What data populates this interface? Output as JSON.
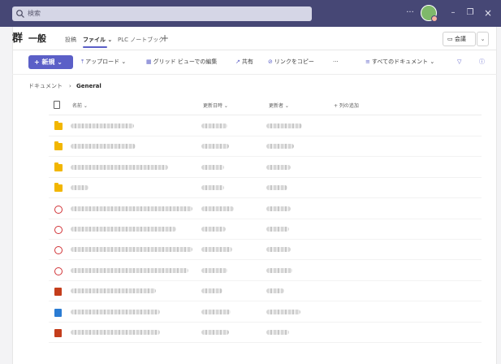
{
  "titlebar": {
    "search_placeholder": "検索",
    "more_label": "···",
    "minimize_label": "–",
    "maximize_label": "❐",
    "close_label": "×"
  },
  "channel": {
    "team_logo_text": "群",
    "name": "一般",
    "tabs": [
      {
        "label": "投稿",
        "active": false
      },
      {
        "label": "ファイル",
        "active": true
      },
      {
        "label": "PLC ノートブック",
        "active": false
      }
    ],
    "add_tab_label": "+",
    "meet_label": "会議"
  },
  "commandbar": {
    "new_label": "新規",
    "upload_label": "アップロード",
    "gridview_label": "グリッド ビューでの編集",
    "share_label": "共有",
    "copylink_label": "リンクをコピー",
    "more_label": "···",
    "view_label": "すべてのドキュメント"
  },
  "breadcrumb": {
    "root": "ドキュメント",
    "current": "General"
  },
  "columns": {
    "name": "名前",
    "modified": "更新日時",
    "modified_by": "更新者",
    "add_column": "+ 列の追加"
  },
  "rows": [
    {
      "type": "folder"
    },
    {
      "type": "folder"
    },
    {
      "type": "folder"
    },
    {
      "type": "folder"
    },
    {
      "type": "pdf"
    },
    {
      "type": "pdf"
    },
    {
      "type": "pdf"
    },
    {
      "type": "pdf"
    },
    {
      "type": "pptx"
    },
    {
      "type": "docx"
    },
    {
      "type": "pptx"
    }
  ],
  "colors": {
    "titlebar": "#464775",
    "accent": "#5b5fc7",
    "folder": "#f2b600",
    "pdf": "#d13438",
    "pptx": "#c43e1c",
    "docx": "#2b7cd3"
  }
}
